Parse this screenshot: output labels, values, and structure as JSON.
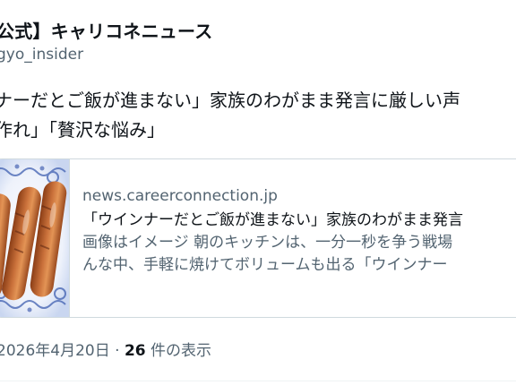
{
  "post": {
    "account_name": "公式】キャリコネニュース",
    "account_handle": "gyo_insider",
    "text_lines": [
      "ナーだとご飯が進まない」家族のわがまま発言に厳しい声",
      "作れ」「贅沢な悩み」"
    ]
  },
  "card": {
    "domain": "news.careerconnection.jp",
    "title": "「ウインナーだとご飯が進まない」家族のわがまま発言",
    "description_lines": [
      "画像はイメージ 朝のキッチンは、一分一秒を争う戦場",
      "んな中、手軽に焼けてボリュームも出る「ウインナー"
    ],
    "thumbnail_icon": "sausage-thumbnail"
  },
  "meta": {
    "date": "2026年4月20日",
    "separator": "·",
    "view_count": "26",
    "view_suffix": "件の表示"
  }
}
